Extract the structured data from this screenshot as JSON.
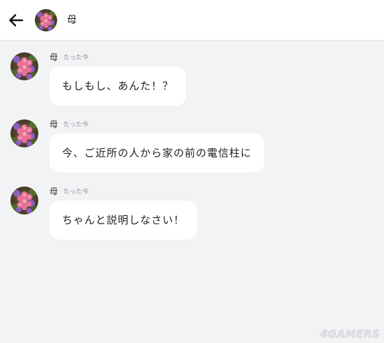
{
  "header": {
    "contact_name": "母"
  },
  "icons": {
    "back": "arrow-left-icon",
    "avatar": "flower-avatar"
  },
  "messages": [
    {
      "sender": "母",
      "time": "たった今",
      "text": "もしもし、あんた！？"
    },
    {
      "sender": "母",
      "time": "たった今",
      "text": "今、ご近所の人から家の前の電信柱に"
    },
    {
      "sender": "母",
      "time": "たった今",
      "text": "ちゃんと説明しなさい！"
    }
  ],
  "watermark": "4GAMERS",
  "colors": {
    "background": "#f2f3f5",
    "header": "#ffffff",
    "bubble": "#ffffff"
  }
}
